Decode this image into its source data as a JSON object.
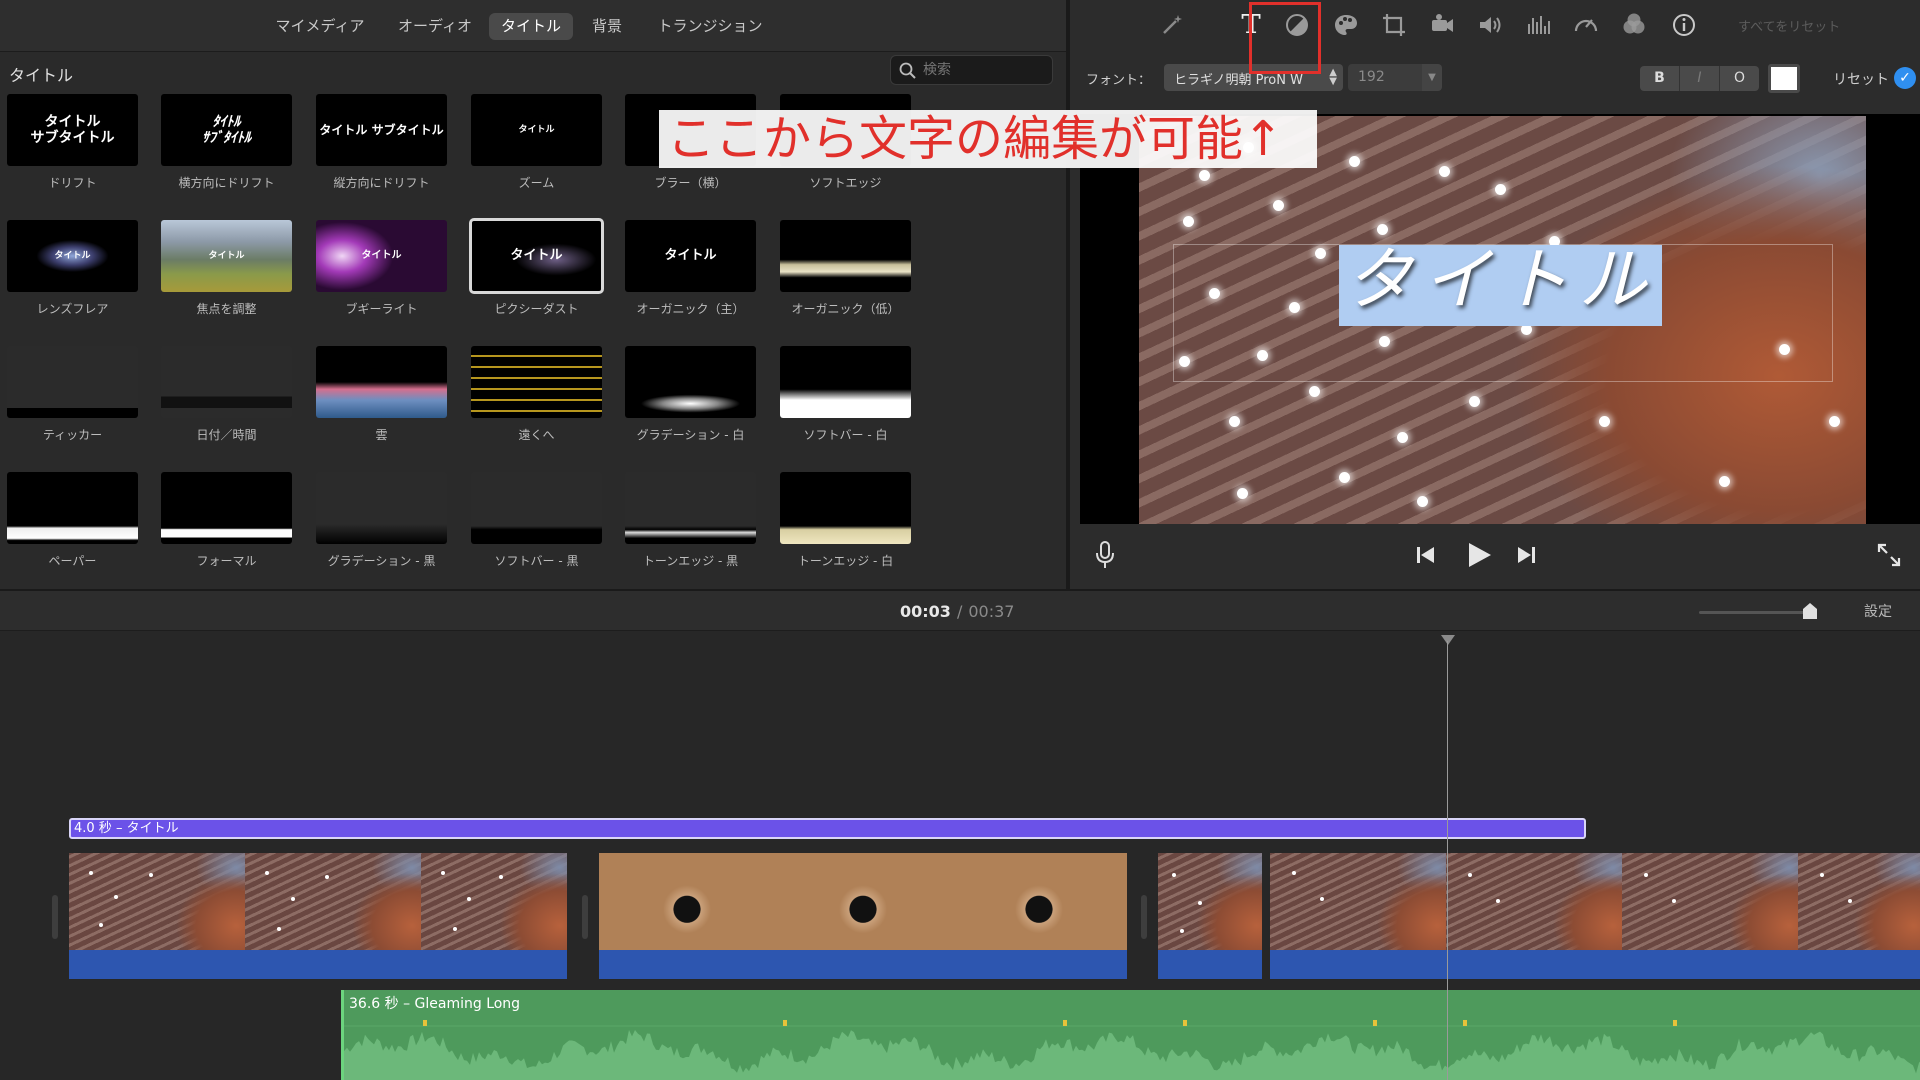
{
  "browser": {
    "tabs": [
      "マイメディア",
      "オーディオ",
      "タイトル",
      "背景",
      "トランジション"
    ],
    "active_tab": "タイトル",
    "section_title": "タイトル",
    "search_placeholder": "検索",
    "tiles": [
      {
        "caption": "ドリフト",
        "thumb_text": "タイトル\nサブタイトル"
      },
      {
        "caption": "横方向にドリフト",
        "thumb_text": "ﾀｲﾄﾙ\nｻﾌﾞﾀｲﾄﾙ"
      },
      {
        "caption": "縦方向にドリフト",
        "thumb_text": "タイトル サブタイトル"
      },
      {
        "caption": "ズーム",
        "thumb_text": "タイトル"
      },
      {
        "caption": "ブラー（横）",
        "thumb_text": ""
      },
      {
        "caption": "ソフトエッジ",
        "thumb_text": ""
      },
      {
        "caption": "レンズフレア",
        "thumb_text": "タイトル"
      },
      {
        "caption": "焦点を調整",
        "thumb_text": "タイトル"
      },
      {
        "caption": "ブギーライト",
        "thumb_text": "タイトル"
      },
      {
        "caption": "ピクシーダスト",
        "thumb_text": "タイトル"
      },
      {
        "caption": "オーガニック（主）",
        "thumb_text": "タイトル"
      },
      {
        "caption": "オーガニック（低）",
        "thumb_text": ""
      },
      {
        "caption": "ティッカー",
        "thumb_text": ""
      },
      {
        "caption": "日付／時間",
        "thumb_text": ""
      },
      {
        "caption": "雲",
        "thumb_text": ""
      },
      {
        "caption": "遠くへ",
        "thumb_text": ""
      },
      {
        "caption": "グラデーション - 白",
        "thumb_text": ""
      },
      {
        "caption": "ソフトバー - 白",
        "thumb_text": ""
      },
      {
        "caption": "ペーパー",
        "thumb_text": ""
      },
      {
        "caption": "フォーマル",
        "thumb_text": ""
      },
      {
        "caption": "グラデーション - 黒",
        "thumb_text": ""
      },
      {
        "caption": "ソフトバー - 黒",
        "thumb_text": ""
      },
      {
        "caption": "トーンエッジ - 黒",
        "thumb_text": ""
      },
      {
        "caption": "トーンエッジ - 白",
        "thumb_text": ""
      }
    ],
    "selected_tile": "ピクシーダスト"
  },
  "viewer": {
    "reset_all_label": "すべてをリセット",
    "font_label": "フォント：",
    "font_value": "ヒラギノ明朝 ProN W",
    "size_value": "192",
    "style_buttons": [
      "B",
      "I",
      "O"
    ],
    "reset_label": "リセット",
    "text_color": "#ffffff",
    "preview_title": "タイトル",
    "annotation": "ここから文字の編集が可能↑",
    "annotation_color": "#e1302b"
  },
  "timeline": {
    "current_time": "00:03",
    "separator": "/",
    "total_time": "00:37",
    "settings_label": "設定",
    "title_clip_label": "4.0 秒 – タイトル",
    "music_clip_label": "36.6 秒 – Gleaming Long"
  },
  "colors": {
    "accent_blue": "#2f8ff0",
    "title_clip": "#6b52e8",
    "video_audio": "#2d56b0",
    "music_clip": "#4e9a5c",
    "highlight_red": "#e1302b"
  }
}
